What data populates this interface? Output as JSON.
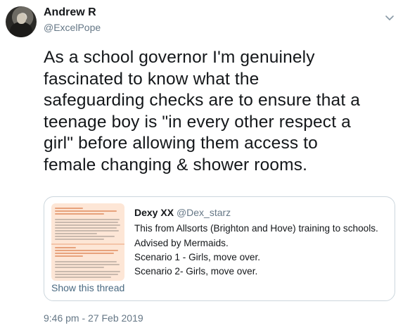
{
  "author": {
    "name": "Andrew R",
    "handle": "@ExcelPope"
  },
  "tweet": {
    "text": "As a school governor I'm genuinely fascinated to know what the safeguarding checks are to ensure that a teenage boy is \"in every other respect a girl\" before allowing them access to female changing & shower rooms.",
    "lines": [
      "As a school governor I'm genuinely",
      "fascinated to know what the",
      "safeguarding checks are to ensure that a",
      "teenage boy is \"in every other respect a",
      "girl\" before allowing them access to",
      "female changing & shower rooms."
    ],
    "timestamp": "9:46 pm - 27 Feb 2019"
  },
  "quoted": {
    "name": "Dexy XX",
    "handle": "@Dex_starz",
    "lines": [
      "This from Allsorts (Brighton and Hove) training to schools.",
      "Advised by Mermaids.",
      "Scenario 1 - Girls, move over.",
      "Scenario 2- Girls, move over."
    ],
    "show_thread": "Show this thread"
  },
  "icons": {
    "menu": "chevron-down-icon"
  }
}
